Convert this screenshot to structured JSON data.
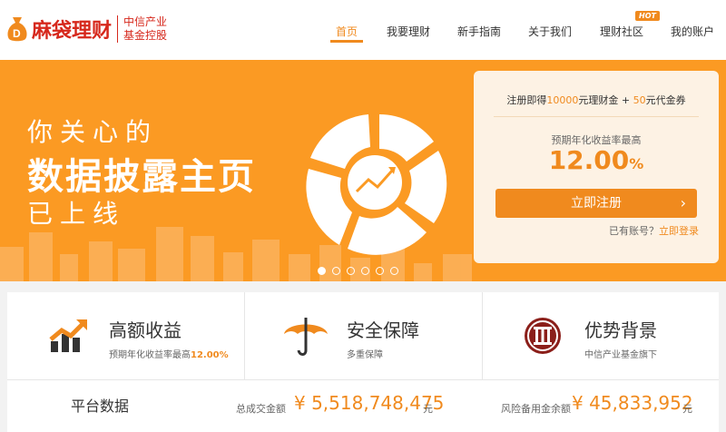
{
  "header": {
    "logo_name": "麻袋理财",
    "logo_sub1": "中信产业",
    "logo_sub2": "基金控股",
    "hot_badge": "HOT",
    "nav": [
      "首页",
      "我要理财",
      "新手指南",
      "关于我们",
      "理财社区",
      "我的账户"
    ],
    "active_index": 0
  },
  "banner": {
    "line1": "你关心的",
    "line2": "数据披露主页",
    "line3": "已上线",
    "slide_count": 6,
    "active_slide": 0
  },
  "register_card": {
    "promo_prefix": "注册即得",
    "promo_amount": "10000",
    "promo_mid": "元理财金 + ",
    "promo_coupon": "50",
    "promo_suffix": "元代金券",
    "rate_label": "预期年化收益率最高",
    "rate_value": "12.00",
    "rate_unit": "%",
    "button_label": "立即注册",
    "button_arrow": "›",
    "login_prompt": "已有账号？",
    "login_link": "立即登录"
  },
  "features": [
    {
      "title": "高额收益",
      "subtitle": "预期年化收益率最高",
      "highlight": "12.00%",
      "icon": "rising-chart-icon"
    },
    {
      "title": "安全保障",
      "subtitle": "多重保障",
      "highlight": "",
      "icon": "umbrella-icon"
    },
    {
      "title": "优势背景",
      "subtitle": "中信产业基金旗下",
      "highlight": "",
      "icon": "citic-logo-icon"
    }
  ],
  "platform": {
    "label": "平台数据",
    "total_label": "总成交金额",
    "total_value": "¥ 5,518,748,475",
    "total_unit": "元",
    "reserve_label": "风险备用金余额",
    "reserve_value": "¥ 45,833,952",
    "reserve_unit": "元"
  },
  "colors": {
    "brand_red": "#d6281c",
    "accent_orange": "#f08a1e",
    "banner_bg": "#fb9a23",
    "card_bg": "#fdf2e4"
  }
}
